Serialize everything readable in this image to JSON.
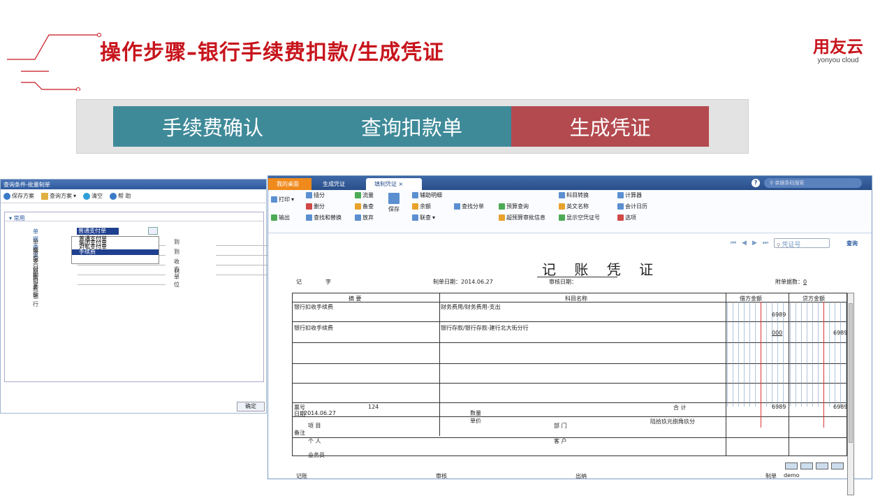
{
  "header": {
    "title": "操作步骤–银行手续费扣款/生成凭证",
    "logo_cn": "用友云",
    "logo_en": "yonyou cloud",
    "brand_color": "#c7141c"
  },
  "steps": [
    {
      "label": "手续费确认",
      "color": "#3f8a99"
    },
    {
      "label": "查询扣款单",
      "color": "#3f8a99"
    },
    {
      "label": "生成凭证",
      "color": "#b34a4f"
    }
  ],
  "dialog": {
    "title": "查询条件-批量制单",
    "toolbar": {
      "save": "保存方案",
      "query": "查询方案",
      "clear": "清空",
      "help": "帮 助"
    },
    "section": "常用",
    "fields": [
      {
        "label": "单据类型",
        "value": "普通支付单"
      },
      {
        "label": "单据号",
        "to": "到"
      },
      {
        "label": "单据日期",
        "to": "到"
      },
      {
        "label": "支付账号",
        "to": "收方单位"
      },
      {
        "label": "原币金额",
        "to": "到"
      },
      {
        "label": "扣款银行"
      }
    ],
    "dropdown": [
      "普通支付单",
      "集团支付单",
      "对私支付单",
      "手续费"
    ],
    "ok": "确定"
  },
  "app": {
    "tabs": [
      "我的桌面",
      "生成凭证",
      "填制凭证"
    ],
    "search_placeholder": "单据条码搜索",
    "help": "?",
    "ribbon": {
      "print": "打印",
      "export": "输出",
      "insert": "插分",
      "delete": "删分",
      "find_replace": "查找和替换",
      "flow": "流量",
      "backup": "备查",
      "abandon": "放弃",
      "save": "保存",
      "aux": "辅助明细",
      "balance": "余额",
      "link": "联查",
      "find_split": "查找分单",
      "budget_query": "预算查询",
      "over_budget": "超预算审批信息",
      "subject_convert": "科目转换",
      "en_name": "英文名称",
      "show_blank": "显示空凭证号",
      "calculator": "计算器",
      "calendar": "会计日历",
      "options": "选项"
    },
    "voucher_search_placeholder": "凭证号",
    "query": "查询"
  },
  "voucher": {
    "title": "记 账 凭 证",
    "type_label": "记",
    "word_label": "字",
    "date_label": "制单日期：2014.06.27",
    "audit_label": "审核日期：",
    "attach_label": "附单据数：",
    "attach_value": "0",
    "col_summary": "摘 要",
    "col_subject": "科目名称",
    "col_debit": "借方金额",
    "col_credit": "贷方金额",
    "rows": [
      {
        "summary": "银行扣收手续费",
        "subject": "财务费用/财务费用-支出",
        "debit": "6989",
        "credit": ""
      },
      {
        "summary": "银行扣收手续费",
        "subject": "银行存款/银行存款-建行北大街分行",
        "debit": "000",
        "credit": "6989"
      }
    ],
    "ticket_label": "票号",
    "ticket_no": "124",
    "date_small": "日期",
    "date_value": "2014.06.27",
    "qty": "数量",
    "price": "单价",
    "total_label": "合 计",
    "total_debit": "6989",
    "total_credit": "6989",
    "amount_words": "陆拾玖元捌角玖分",
    "notes": "备注",
    "project": "项 目",
    "dept": "部 门",
    "person": "个 人",
    "customer": "客 户",
    "salesman": "业务员",
    "bookkeeping": "记账",
    "audit": "审核",
    "cashier": "出纳",
    "maker": "制单",
    "maker_name": "demo"
  }
}
